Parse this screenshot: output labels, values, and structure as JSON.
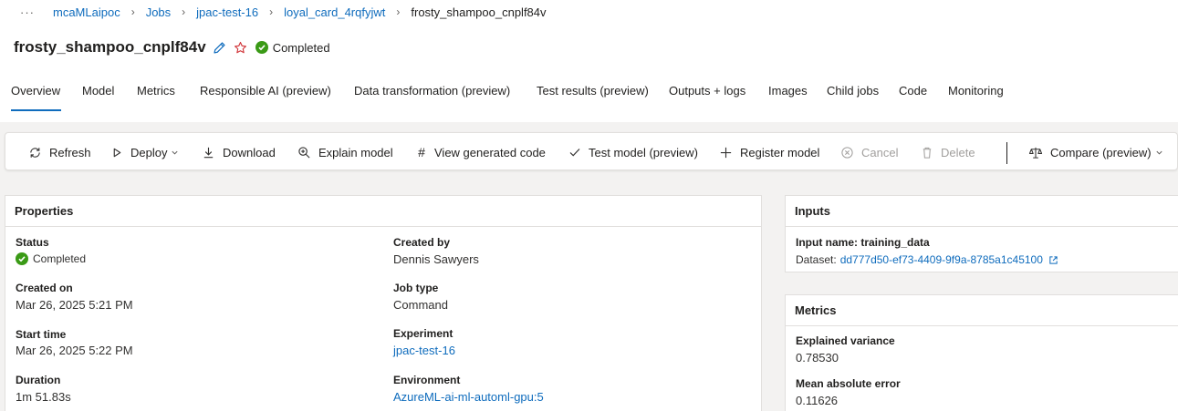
{
  "breadcrumb": {
    "more": "···",
    "items": [
      "mcaMLaipoc",
      "Jobs",
      "jpac-test-16",
      "loyal_card_4rqfyjwt"
    ],
    "current": "frosty_shampoo_cnplf84v"
  },
  "header": {
    "title": "frosty_shampoo_cnplf84v",
    "status": "Completed"
  },
  "tabs": [
    "Overview",
    "Model",
    "Metrics",
    "Responsible AI (preview)",
    "Data transformation (preview)",
    "Test results (preview)",
    "Outputs + logs",
    "Images",
    "Child jobs",
    "Code",
    "Monitoring"
  ],
  "toolbar": {
    "refresh": "Refresh",
    "deploy": "Deploy",
    "download": "Download",
    "explain": "Explain model",
    "view_code": "View generated code",
    "test_model": "Test model (preview)",
    "register": "Register model",
    "cancel": "Cancel",
    "delete": "Delete",
    "compare": "Compare (preview)"
  },
  "properties": {
    "title": "Properties",
    "status_label": "Status",
    "status_value": "Completed",
    "created_on_label": "Created on",
    "created_on_value": "Mar 26, 2025 5:21 PM",
    "start_time_label": "Start time",
    "start_time_value": "Mar 26, 2025 5:22 PM",
    "duration_label": "Duration",
    "duration_value": "1m 51.83s",
    "created_by_label": "Created by",
    "created_by_value": "Dennis Sawyers",
    "job_type_label": "Job type",
    "job_type_value": "Command",
    "experiment_label": "Experiment",
    "experiment_value": "jpac-test-16",
    "environment_label": "Environment",
    "environment_value": "AzureML-ai-ml-automl-gpu:5"
  },
  "inputs": {
    "title": "Inputs",
    "input_name": "Input name: training_data",
    "dataset_label": "Dataset:",
    "dataset_value": "dd777d50-ef73-4409-9f9a-8785a1c45100"
  },
  "metrics": {
    "title": "Metrics",
    "explained_variance_label": "Explained variance",
    "explained_variance_value": "0.78530",
    "mae_label": "Mean absolute error",
    "mae_value": "0.11626"
  },
  "colors": {
    "accent": "#0f6cbd",
    "success": "#3a9a16",
    "favorite": "#d13438",
    "disabled": "#a19f9d"
  }
}
